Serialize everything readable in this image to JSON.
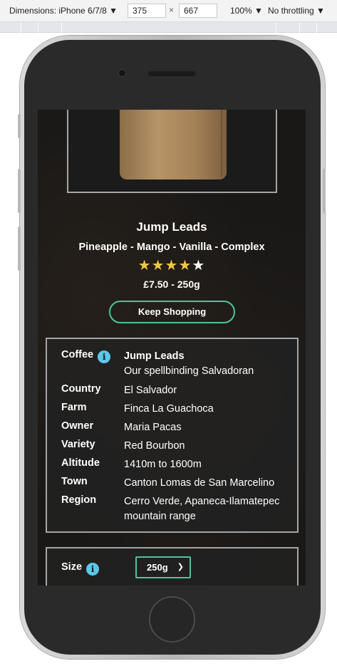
{
  "devtools": {
    "dimensions_label": "Dimensions: iPhone 6/7/8 ▼",
    "width": "375",
    "height": "667",
    "times": "×",
    "zoom": "100% ▼",
    "throttling": "No throttling ▼"
  },
  "product": {
    "name": "Jump Leads",
    "flavours": "Pineapple - Mango - Vanilla - Complex",
    "rating": 4,
    "rating_max": 5,
    "price": "£7.50 - 250g",
    "keep_shopping_label": "Keep Shopping"
  },
  "details": {
    "coffee_label": "Coffee",
    "coffee_name": "Jump Leads",
    "coffee_desc": "Our spellbinding Salvadoran",
    "rows": [
      {
        "label": "Country",
        "value": "El Salvador"
      },
      {
        "label": "Farm",
        "value": "Finca La Guachoca"
      },
      {
        "label": "Owner",
        "value": "Maria Pacas"
      },
      {
        "label": "Variety",
        "value": "Red Bourbon"
      },
      {
        "label": "Altitude",
        "value": "1410m to 1600m"
      },
      {
        "label": "Town",
        "value": "Canton Lomas de San Marcelino"
      },
      {
        "label": "Region",
        "value": "Cerro Verde, Apaneca-Ilamatepec mountain range"
      }
    ],
    "info_icon": "info-icon"
  },
  "size": {
    "label": "Size",
    "selected": "250g",
    "chevron_icon": "chevron-down-icon"
  },
  "colors": {
    "accent": "#4fc3a1",
    "info": "#5bc8e8",
    "star": "#f3c640"
  }
}
